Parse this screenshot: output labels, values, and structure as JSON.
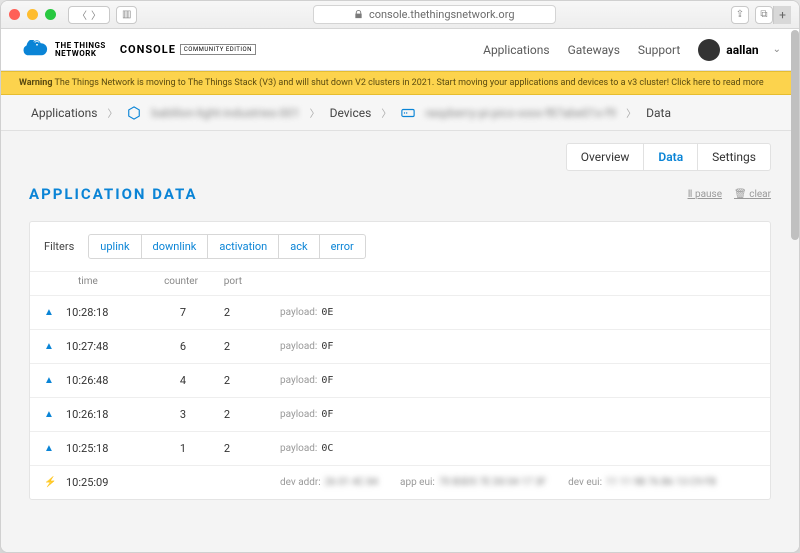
{
  "browser": {
    "url": "console.thethingsnetwork.org"
  },
  "logo": {
    "line1": "THE THINGS",
    "line2": "NETWORK",
    "console": "CONSOLE",
    "edition": "COMMUNITY EDITION"
  },
  "header_nav": {
    "applications": "Applications",
    "gateways": "Gateways",
    "support": "Support"
  },
  "user": {
    "name": "aallan"
  },
  "warning": {
    "prefix": "Warning",
    "body": "  The Things Network is moving to The Things Stack (V3) and will shut down V2 clusters in 2021. Start moving your applications and devices to a v3 cluster! Click here to read more"
  },
  "breadcrumb": {
    "root": "Applications",
    "app_blurred": "bablilon-light-industries-001",
    "devices": "Devices",
    "device_blurred": "raspberry-pi-pico-xxxx-f87abe01x-f9",
    "leaf": "Data"
  },
  "tabs": {
    "overview": "Overview",
    "data": "Data",
    "settings": "Settings"
  },
  "page": {
    "title": "APPLICATION DATA",
    "pause": "pause",
    "clear": "clear"
  },
  "filters": {
    "label": "Filters",
    "options": [
      "uplink",
      "downlink",
      "activation",
      "ack",
      "error"
    ]
  },
  "columns": {
    "time": "time",
    "counter": "counter",
    "port": "port"
  },
  "labels": {
    "payload": "payload:",
    "dev_addr": "dev addr:",
    "app_eui": "app eui:",
    "dev_eui": "dev eui:"
  },
  "rows": [
    {
      "type": "uplink",
      "time": "10:28:18",
      "counter": "7",
      "port": "2",
      "payload": "0E"
    },
    {
      "type": "uplink",
      "time": "10:27:48",
      "counter": "6",
      "port": "2",
      "payload": "0F"
    },
    {
      "type": "uplink",
      "time": "10:26:48",
      "counter": "4",
      "port": "2",
      "payload": "0F"
    },
    {
      "type": "uplink",
      "time": "10:26:18",
      "counter": "3",
      "port": "2",
      "payload": "0F"
    },
    {
      "type": "uplink",
      "time": "10:25:18",
      "counter": "1",
      "port": "2",
      "payload": "0C"
    },
    {
      "type": "activation",
      "time": "10:25:09",
      "dev_addr": "26 01 4C 84",
      "app_eui": "70 B3D5 7E D0 04 17 3F",
      "dev_eui": "11 11 9B 76 B6 13 C9 FB"
    }
  ]
}
